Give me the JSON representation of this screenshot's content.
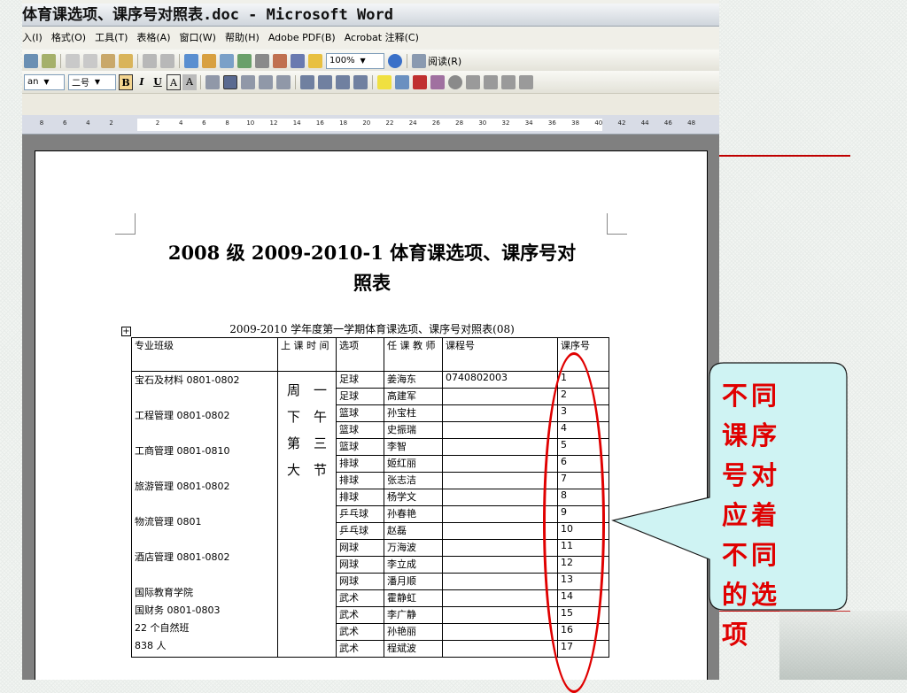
{
  "window": {
    "title": "体育课选项、课序号对照表.doc - Microsoft Word"
  },
  "menu": {
    "items": [
      "入(I)",
      "格式(O)",
      "工具(T)",
      "表格(A)",
      "窗口(W)",
      "帮助(H)",
      "Adobe PDF(B)",
      "Acrobat 注释(C)"
    ]
  },
  "toolbar": {
    "zoom": "100%",
    "read_label": "阅读(R)"
  },
  "format_bar": {
    "font": "an",
    "size": "二号",
    "bold": "B",
    "italic": "I",
    "underline": "U",
    "char_a": "A",
    "char_a2": "A"
  },
  "ruler": {
    "ticks": [
      "8",
      "6",
      "4",
      "2",
      "",
      "2",
      "4",
      "6",
      "8",
      "10",
      "12",
      "14",
      "16",
      "18",
      "20",
      "22",
      "24",
      "26",
      "28",
      "30",
      "32",
      "34",
      "36",
      "38",
      "40",
      "42",
      "44",
      "46",
      "48"
    ]
  },
  "document": {
    "title_line1": "2008 级 2009-2010-1 体育课选项、课序号对",
    "title_line2": "照表",
    "subtitle": "2009-2010 学年度第一学期体育课选项、课序号对照表(08)",
    "table": {
      "headers": [
        "专业班级",
        "上 课 时 间",
        "选项",
        "任 课 教 师",
        "课程号",
        "课序号"
      ],
      "majors": [
        "宝石及材料 0801-0802",
        "",
        "工程管理 0801-0802",
        "",
        "工商管理 0801-0810",
        "",
        "旅游管理 0801-0802",
        "",
        "物流管理 0801",
        "",
        "酒店管理 0801-0802",
        "",
        "国际教育学院",
        "国财务 0801-0803",
        "22 个自然班",
        "838 人"
      ],
      "time": [
        "周　一",
        "下　午",
        "第　三",
        "大　节"
      ],
      "rows": [
        [
          "足球",
          "姜海东",
          "0740802003",
          "1"
        ],
        [
          "足球",
          "高建军",
          "",
          "2"
        ],
        [
          "篮球",
          "孙宝柱",
          "",
          "3"
        ],
        [
          "篮球",
          "史振瑞",
          "",
          "4"
        ],
        [
          "篮球",
          "李智",
          "",
          "5"
        ],
        [
          "排球",
          "姬红丽",
          "",
          "6"
        ],
        [
          "排球",
          "张志洁",
          "",
          "7"
        ],
        [
          "排球",
          "杨学文",
          "",
          "8"
        ],
        [
          "乒乓球",
          "孙春艳",
          "",
          "9"
        ],
        [
          "乒乓球",
          "赵磊",
          "",
          "10"
        ],
        [
          "网球",
          "万海波",
          "",
          "11"
        ],
        [
          "网球",
          "李立成",
          "",
          "12"
        ],
        [
          "网球",
          "潘月顺",
          "",
          "13"
        ],
        [
          "武术",
          "霍静虹",
          "",
          "14"
        ],
        [
          "武术",
          "李广静",
          "",
          "15"
        ],
        [
          "武术",
          "孙艳丽",
          "",
          "16"
        ],
        [
          "武术",
          "程斌波",
          "",
          "17"
        ]
      ]
    }
  },
  "annotation": {
    "text": "不同课序号对应着不同的选项",
    "color": "#e00000"
  }
}
